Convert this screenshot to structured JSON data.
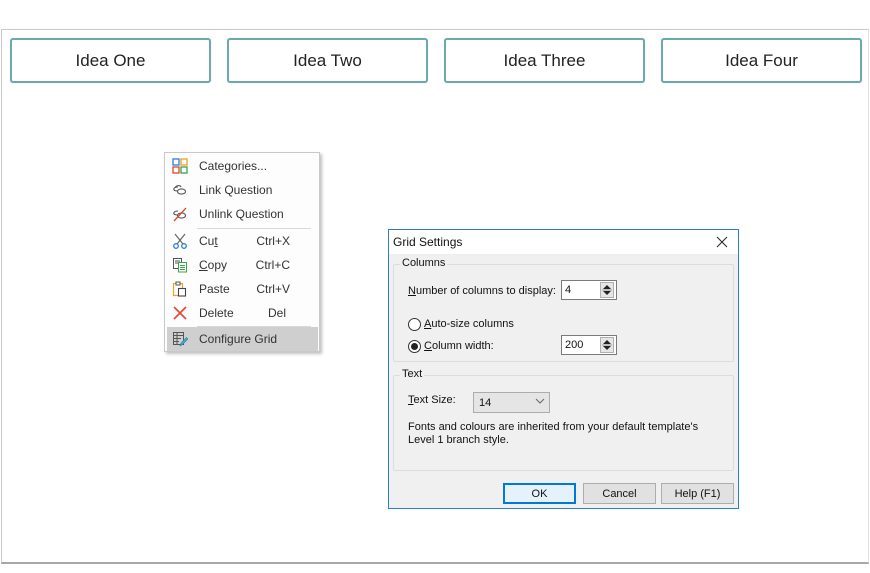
{
  "canvas": {
    "ideas": [
      {
        "label": "Idea One"
      },
      {
        "label": "Idea Two"
      },
      {
        "label": "Idea Three"
      },
      {
        "label": "Idea Four"
      }
    ],
    "idea_border_color": "#6aa9ac"
  },
  "context_menu": {
    "items": [
      {
        "icon": "categories-icon",
        "label": "Categories...",
        "shortcut": ""
      },
      {
        "icon": "link-icon",
        "label": "Link Question",
        "shortcut": ""
      },
      {
        "icon": "unlink-icon",
        "label": "Unlink Question",
        "shortcut": ""
      },
      {
        "icon": "cut-icon",
        "label_pre": "Cu",
        "label_u": "t",
        "label_post": "",
        "shortcut": "Ctrl+X"
      },
      {
        "icon": "copy-icon",
        "label_pre": "",
        "label_u": "C",
        "label_post": "opy",
        "shortcut": "Ctrl+C"
      },
      {
        "icon": "paste-icon",
        "label": "Paste",
        "shortcut": "Ctrl+V"
      },
      {
        "icon": "delete-icon",
        "label": "Delete",
        "shortcut": "Del"
      },
      {
        "icon": "configure-grid-icon",
        "label": "Configure Grid",
        "shortcut": "",
        "highlighted": true
      }
    ]
  },
  "dialog": {
    "title": "Grid Settings",
    "columns_group": {
      "label": "Columns",
      "num_columns_label_u": "N",
      "num_columns_label_rest": "umber of columns to display:",
      "num_columns_value": "4",
      "auto_size_label_u": "A",
      "auto_size_label_rest": "uto-size columns",
      "auto_size_selected": false,
      "column_width_label_u": "C",
      "column_width_label_rest": "olumn width:",
      "column_width_selected": true,
      "column_width_value": "200"
    },
    "text_group": {
      "label": "Text",
      "text_size_label_u": "T",
      "text_size_label_rest": "ext Size:",
      "text_size_value": "14",
      "info_line1": "Fonts and colours are inherited from your default template's",
      "info_line2": "Level 1 branch style."
    },
    "buttons": {
      "ok": "OK",
      "cancel": "Cancel",
      "help": "Help (F1)"
    },
    "accent_color": "#0078d7"
  }
}
